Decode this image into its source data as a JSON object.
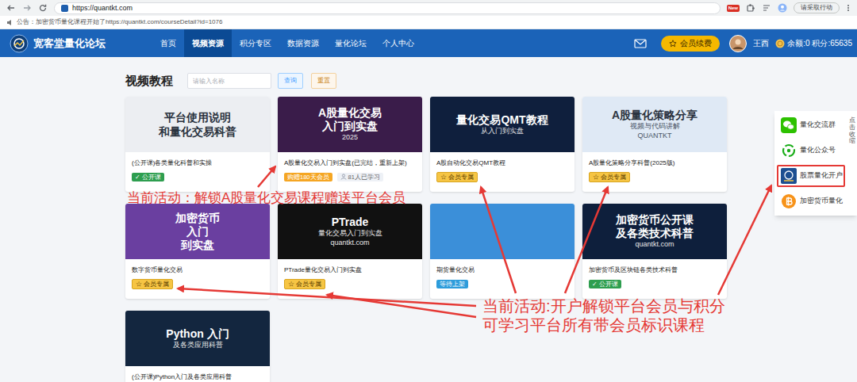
{
  "browser": {
    "url": "https://quantkt.com",
    "new_badge": "New",
    "action_button": "请采取行动"
  },
  "announcement": "公告：加密货币量化课程开始了https://quantkt.com/courseDetail?id=1076",
  "site_name": "宽客堂量化论坛",
  "nav": [
    {
      "label": "首页",
      "selected": false
    },
    {
      "label": "视频资源",
      "selected": true
    },
    {
      "label": "积分专区",
      "selected": false
    },
    {
      "label": "数据资源",
      "selected": false
    },
    {
      "label": "量化论坛",
      "selected": false
    },
    {
      "label": "个人中心",
      "selected": false
    }
  ],
  "header": {
    "renew_button": "会员续费",
    "user_name": "王西",
    "balance": "余额:0 积分:65635"
  },
  "page": {
    "title": "视频教程",
    "search_placeholder": "请输入名称",
    "search_button": "查询",
    "reset_button": "重置"
  },
  "courses": [
    {
      "cover": {
        "color": "#eceef2",
        "kind": "light",
        "lines": [
          {
            "text": "平台使用说明",
            "kind": "title"
          },
          {
            "text": "和量化交易科普",
            "kind": "title"
          }
        ]
      },
      "title": "(公开课)各类量化科普和实操",
      "badges": [
        {
          "icon": "✓",
          "text": "公开课",
          "kind": "public"
        }
      ]
    },
    {
      "cover": {
        "color": "#3a1c4a",
        "kind": "dark",
        "lines": [
          {
            "text": "A股量化交易",
            "kind": "title"
          },
          {
            "text": "入门到实盘",
            "kind": "title"
          },
          {
            "text": "2025",
            "kind": "subtitle"
          }
        ]
      },
      "title": "A股量化交易入门到实盘(已完结，重新上架)",
      "badges": [
        {
          "text": "购赠180天会员",
          "kind": "gift"
        },
        {
          "text": "81人已学习",
          "kind": "learners"
        }
      ]
    },
    {
      "cover": {
        "color": "#0f1f3d",
        "kind": "dark",
        "lines": [
          {
            "text": "量化交易QMT教程",
            "kind": "title"
          },
          {
            "text": "从入门到实盘",
            "kind": "subtitle"
          }
        ]
      },
      "title": "A股自动化交易QMT教程",
      "badges": [
        {
          "icon": "☆",
          "text": "会员专属",
          "kind": "member"
        }
      ]
    },
    {
      "cover": {
        "color": "#dfe9f5",
        "kind": "light",
        "lines": [
          {
            "text": "A股量化策略分享",
            "kind": "title"
          },
          {
            "text": "视频与代码讲解",
            "kind": "subtitle"
          },
          {
            "text": "QUANTKT",
            "kind": "subtitle"
          }
        ]
      },
      "title": "A股量化策略分享科普(2025版)",
      "badges": [
        {
          "icon": "☆",
          "text": "会员专属",
          "kind": "member"
        }
      ]
    },
    {
      "cover": {
        "color": "#6a3fa0",
        "kind": "dark",
        "lines": [
          {
            "text": "加密货币",
            "kind": "title"
          },
          {
            "text": "入门",
            "kind": "title"
          },
          {
            "text": "到实盘",
            "kind": "title"
          }
        ]
      },
      "title": "数字货币量化交易",
      "badges": [
        {
          "icon": "☆",
          "text": "会员专属",
          "kind": "member"
        }
      ]
    },
    {
      "cover": {
        "color": "#111111",
        "kind": "dark",
        "lines": [
          {
            "text": "PTrade",
            "kind": "title"
          },
          {
            "text": "量化交易入门到实盘",
            "kind": "subtitle"
          },
          {
            "text": "quantkt.com",
            "kind": "subtitle"
          }
        ]
      },
      "title": "PTrade量化交易入门到实盘",
      "badges": [
        {
          "icon": "☆",
          "text": "会员专属",
          "kind": "member"
        }
      ]
    },
    {
      "cover": {
        "color": "#3b8fd9",
        "kind": "dark",
        "lines": []
      },
      "title": "期货量化交易",
      "badges": [
        {
          "text": "等待上架",
          "kind": "pending"
        }
      ]
    },
    {
      "cover": {
        "color": "#0e1f3c",
        "kind": "dark",
        "lines": [
          {
            "text": "加密货币公开课",
            "kind": "title"
          },
          {
            "text": "及各类技术科普",
            "kind": "title"
          },
          {
            "text": "quantkt.com",
            "kind": "subtitle"
          }
        ]
      },
      "title": "加密货币及区块链各类技术科普",
      "badges": [
        {
          "icon": "✓",
          "text": "公开课",
          "kind": "public"
        }
      ]
    },
    {
      "cover": {
        "color": "#13263f",
        "kind": "dark",
        "lines": [
          {
            "text": "Python 入门",
            "kind": "title"
          },
          {
            "text": "及各类应用科普",
            "kind": "subtitle"
          }
        ]
      },
      "title": "(公开课)Python入门及各类应用科普",
      "badges": []
    }
  ],
  "side_panel": {
    "items": [
      {
        "label": "量化交流群",
        "kind": "wechat",
        "highlighted": false
      },
      {
        "label": "量化公众号",
        "kind": "official",
        "highlighted": false
      },
      {
        "label": "股票量化开户",
        "kind": "logo",
        "highlighted": true
      },
      {
        "label": "加密货币量化",
        "kind": "bitcoin",
        "highlighted": false
      }
    ],
    "collapse": "点击收缩"
  },
  "annotations": [
    {
      "lines": [
        "当前活动：解锁A股量化交易课程赠送平台会员"
      ]
    },
    {
      "lines": [
        "当前活动:开户解锁平台会员与积分",
        "可学习平台所有带会员标识课程"
      ]
    }
  ]
}
